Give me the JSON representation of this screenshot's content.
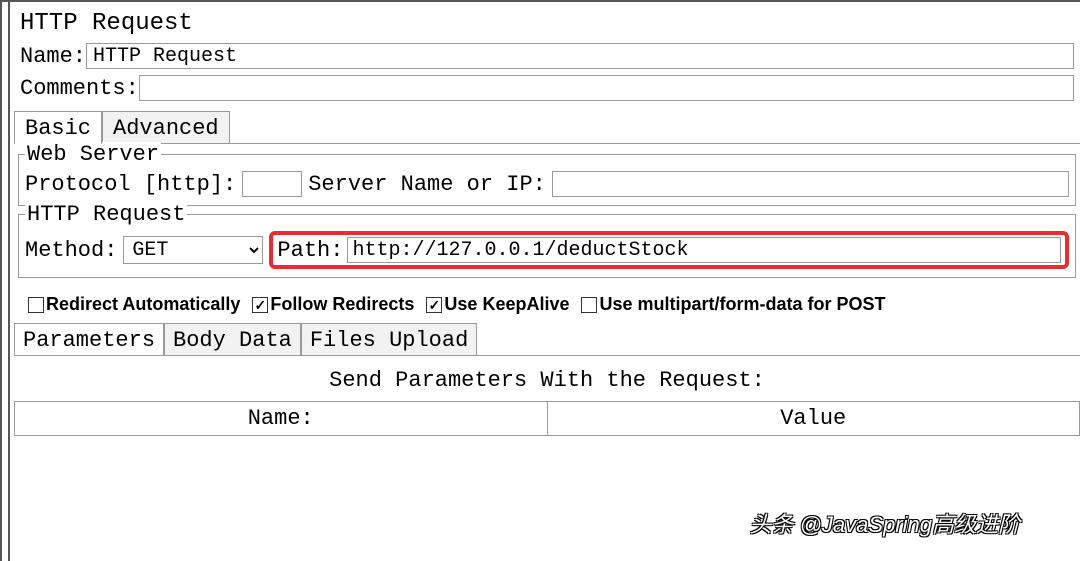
{
  "title": "HTTP Request",
  "name": {
    "label": "Name:",
    "value": "HTTP Request"
  },
  "comments": {
    "label": "Comments:",
    "value": ""
  },
  "tabs": {
    "basic": "Basic",
    "advanced": "Advanced"
  },
  "web_server": {
    "title": "Web Server",
    "protocol_label": "Protocol [http]:",
    "protocol_value": "",
    "server_label": "Server Name or IP:",
    "server_value": ""
  },
  "http_request": {
    "title": "HTTP Request",
    "method_label": "Method:",
    "method_value": "GET",
    "path_label": "Path:",
    "path_value": "http://127.0.0.1/deductStock"
  },
  "checkboxes": {
    "redirect_auto": {
      "label": "Redirect Automatically",
      "checked": false
    },
    "follow_redirects": {
      "label": "Follow Redirects",
      "checked": true
    },
    "keepalive": {
      "label": "Use KeepAlive",
      "checked": true
    },
    "multipart": {
      "label": "Use multipart/form-data for POST",
      "checked": false
    }
  },
  "sub_tabs": {
    "parameters": "Parameters",
    "body_data": "Body Data",
    "files_upload": "Files Upload"
  },
  "params_table": {
    "caption": "Send Parameters With the Request:",
    "col_name": "Name:",
    "col_value": "Value"
  },
  "watermark": "头条 @JavaSpring高级进阶"
}
